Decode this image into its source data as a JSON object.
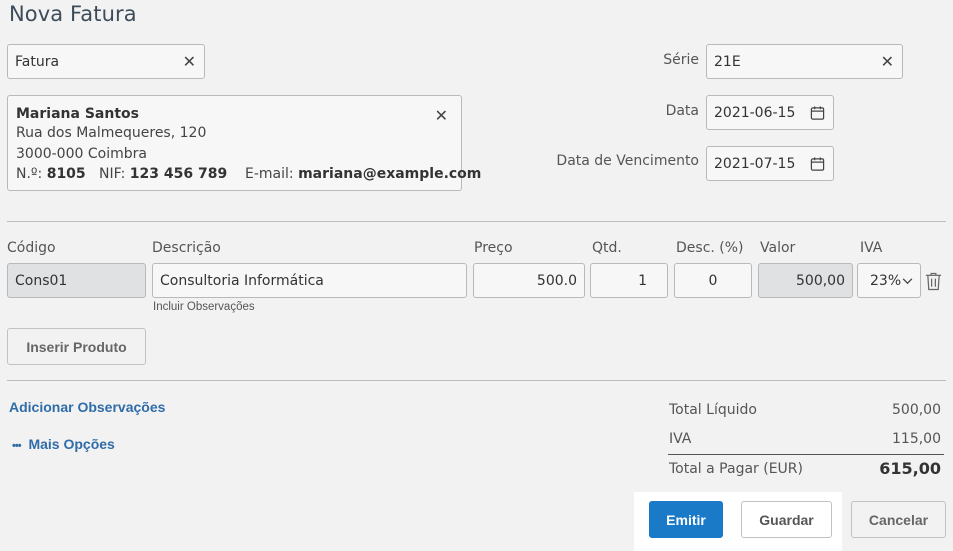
{
  "page": {
    "title": "Nova Fatura"
  },
  "doc_type": {
    "value": "Fatura"
  },
  "client": {
    "name": "Mariana Santos",
    "address": "Rua dos Malmequeres, 120",
    "postal_city": "3000-000 Coimbra",
    "number_label": "N.º:",
    "number": "8105",
    "nif_label": "NIF:",
    "nif": "123 456 789",
    "email_label": "E-mail:",
    "email": "mariana@example.com"
  },
  "serie": {
    "label": "Série",
    "value": "21E"
  },
  "data": {
    "label": "Data",
    "value": "2021-06-15"
  },
  "vencimento": {
    "label": "Data de Vencimento",
    "value": "2021-07-15"
  },
  "columns": {
    "codigo": "Código",
    "descricao": "Descrição",
    "preco": "Preço",
    "qtd": "Qtd.",
    "desc": "Desc. (%)",
    "valor": "Valor",
    "iva": "IVA"
  },
  "line": {
    "codigo": "Cons01",
    "descricao": "Consultoria Informática",
    "preco": "500.0",
    "qtd": "1",
    "desc": "0",
    "valor": "500,00",
    "iva": "23%",
    "notes_link": "Incluir Observações"
  },
  "buttons": {
    "insert_product": "Inserir Produto",
    "emit": "Emitir",
    "save": "Guardar",
    "cancel": "Cancelar"
  },
  "links": {
    "add_notes": "Adicionar Observações",
    "more_options_dots": "•••",
    "more_options": "Mais Opções"
  },
  "totals": {
    "net_label": "Total Líquido",
    "net_value": "500,00",
    "vat_label": "IVA",
    "vat_value": "115,00",
    "total_label": "Total a Pagar (EUR)",
    "total_value": "615,00"
  },
  "colors": {
    "primary": "#1a7ac8",
    "link": "#2f6ca8",
    "background": "#f2f2f2"
  },
  "icons": [
    "close-icon",
    "calendar-icon",
    "chevron-down-icon",
    "trash-icon"
  ]
}
